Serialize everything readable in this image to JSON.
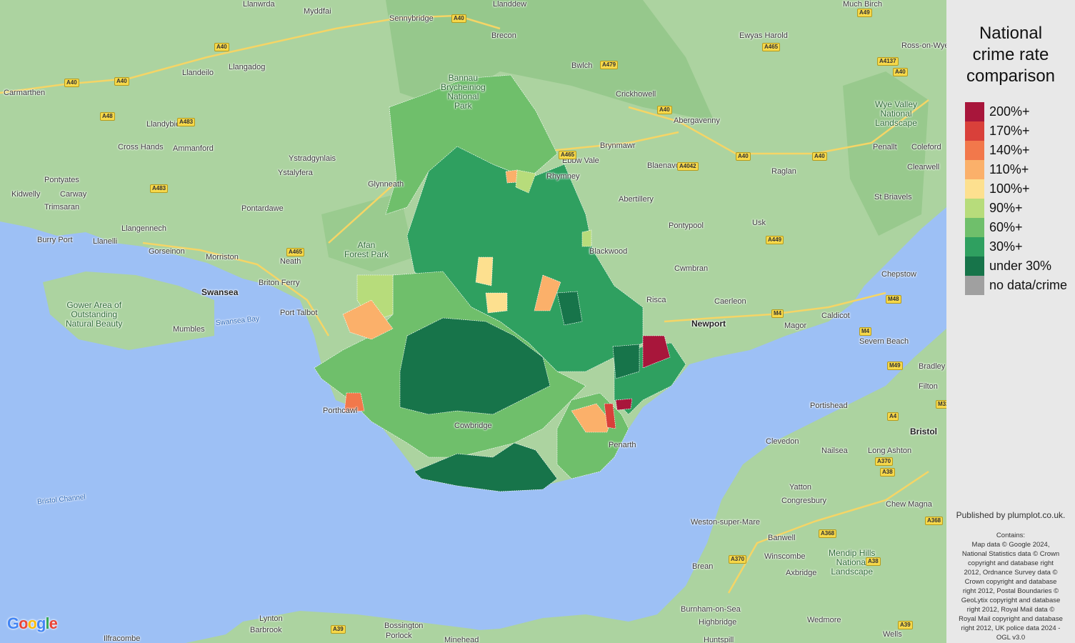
{
  "legend": {
    "title_lines": [
      "National",
      "crime rate",
      "comparison"
    ],
    "items": [
      {
        "label": "200%+",
        "color": "#a8163b"
      },
      {
        "label": "170%+",
        "color": "#d9403a"
      },
      {
        "label": "140%+",
        "color": "#f2784b"
      },
      {
        "label": "110%+",
        "color": "#fbb06a"
      },
      {
        "label": "100%+",
        "color": "#fde08f"
      },
      {
        "label": "90%+",
        "color": "#b7dc7b"
      },
      {
        "label": "60%+",
        "color": "#6fbf6b"
      },
      {
        "label": "30%+",
        "color": "#2fa060"
      },
      {
        "label": "under 30%",
        "color": "#17744a"
      },
      {
        "label": "no data/crime",
        "color": "#a0a0a0"
      }
    ]
  },
  "attribution": {
    "published": "Published by plumplot.co.uk.",
    "contains_lines": [
      "Contains:",
      "Map data © Google 2024,",
      "National Statistics data © Crown",
      "copyright and database right",
      "2012, Ordnance Survey data ©",
      "Crown copyright and database",
      "right 2012, Postal Boundaries ©",
      "GeoLytix copyright and database",
      "right 2012, Royal Mail data ©",
      "Royal Mail copyright and database",
      "right 2012, UK police data 2024 -",
      "OGL v3.0"
    ]
  },
  "map": {
    "google_logo": "Google",
    "places": [
      {
        "name": "Llanwrda",
        "kind": "place"
      },
      {
        "name": "Myddfai",
        "kind": "place"
      },
      {
        "name": "Sennybridge",
        "kind": "place"
      },
      {
        "name": "Llanddew",
        "kind": "place"
      },
      {
        "name": "Brecon",
        "kind": "place"
      },
      {
        "name": "Ewyas Harold",
        "kind": "place"
      },
      {
        "name": "Much Birch",
        "kind": "place"
      },
      {
        "name": "Llangadog",
        "kind": "place"
      },
      {
        "name": "Ross-on-Wye",
        "kind": "place"
      },
      {
        "name": "Llandeilo",
        "kind": "place"
      },
      {
        "name": "Bwlch",
        "kind": "place"
      },
      {
        "name": "Carmarthen",
        "kind": "place"
      },
      {
        "name": "Crickhowell",
        "kind": "place"
      },
      {
        "name": "Llandybie",
        "kind": "place"
      },
      {
        "name": "Abergavenny",
        "kind": "place"
      },
      {
        "name": "Cross Hands",
        "kind": "place"
      },
      {
        "name": "Ammanford",
        "kind": "place"
      },
      {
        "name": "Brynmawr",
        "kind": "place"
      },
      {
        "name": "Penallt",
        "kind": "place"
      },
      {
        "name": "Coleford",
        "kind": "place"
      },
      {
        "name": "Ebbw Vale",
        "kind": "place"
      },
      {
        "name": "Ystradgynlais",
        "kind": "place"
      },
      {
        "name": "Pontyates",
        "kind": "place"
      },
      {
        "name": "Ystalyfera",
        "kind": "place"
      },
      {
        "name": "Blaenavon",
        "kind": "place"
      },
      {
        "name": "Raglan",
        "kind": "place"
      },
      {
        "name": "Clearwell",
        "kind": "place"
      },
      {
        "name": "Kidwelly",
        "kind": "place"
      },
      {
        "name": "Carway",
        "kind": "place"
      },
      {
        "name": "Glynneath",
        "kind": "place"
      },
      {
        "name": "Rhymney",
        "kind": "place"
      },
      {
        "name": "Trimsaran",
        "kind": "place"
      },
      {
        "name": "Abertillery",
        "kind": "place"
      },
      {
        "name": "St Briavels",
        "kind": "place"
      },
      {
        "name": "Pontardawe",
        "kind": "place"
      },
      {
        "name": "Llangennech",
        "kind": "place"
      },
      {
        "name": "Pontypool",
        "kind": "place"
      },
      {
        "name": "Burry Port",
        "kind": "place"
      },
      {
        "name": "Usk",
        "kind": "place"
      },
      {
        "name": "Llanelli",
        "kind": "place"
      },
      {
        "name": "Gorseinon",
        "kind": "place"
      },
      {
        "name": "Morriston",
        "kind": "place"
      },
      {
        "name": "Blackwood",
        "kind": "place"
      },
      {
        "name": "Neath",
        "kind": "place"
      },
      {
        "name": "Cwmbran",
        "kind": "place"
      },
      {
        "name": "Chepstow",
        "kind": "place"
      },
      {
        "name": "Briton Ferry",
        "kind": "place"
      },
      {
        "name": "Swansea",
        "kind": "big"
      },
      {
        "name": "Risca",
        "kind": "place"
      },
      {
        "name": "Caerleon",
        "kind": "place"
      },
      {
        "name": "Caldicot",
        "kind": "place"
      },
      {
        "name": "Port Talbot",
        "kind": "place"
      },
      {
        "name": "Newport",
        "kind": "big"
      },
      {
        "name": "Magor",
        "kind": "place"
      },
      {
        "name": "Mumbles",
        "kind": "place"
      },
      {
        "name": "Severn Beach",
        "kind": "place"
      },
      {
        "name": "Bradley",
        "kind": "place"
      },
      {
        "name": "Filton",
        "kind": "place"
      },
      {
        "name": "Porthcawl",
        "kind": "place"
      },
      {
        "name": "Portishead",
        "kind": "place"
      },
      {
        "name": "Cowbridge",
        "kind": "place"
      },
      {
        "name": "Bristol",
        "kind": "big"
      },
      {
        "name": "Clevedon",
        "kind": "place"
      },
      {
        "name": "Nailsea",
        "kind": "place"
      },
      {
        "name": "Long Ashton",
        "kind": "place"
      },
      {
        "name": "Yatton",
        "kind": "place"
      },
      {
        "name": "Congresbury",
        "kind": "place"
      },
      {
        "name": "Chew Magna",
        "kind": "place"
      },
      {
        "name": "Weston-super-Mare",
        "kind": "place"
      },
      {
        "name": "Banwell",
        "kind": "place"
      },
      {
        "name": "Winscombe",
        "kind": "place"
      },
      {
        "name": "Brean",
        "kind": "place"
      },
      {
        "name": "Axbridge",
        "kind": "place"
      },
      {
        "name": "Burnham-on-Sea",
        "kind": "place"
      },
      {
        "name": "Wedmore",
        "kind": "place"
      },
      {
        "name": "Highbridge",
        "kind": "place"
      },
      {
        "name": "Lynton",
        "kind": "place"
      },
      {
        "name": "Barbrook",
        "kind": "place"
      },
      {
        "name": "Bossington",
        "kind": "place"
      },
      {
        "name": "Porlock",
        "kind": "place"
      },
      {
        "name": "Ilfracombe",
        "kind": "place"
      },
      {
        "name": "Minehead",
        "kind": "place"
      },
      {
        "name": "Wells",
        "kind": "place"
      },
      {
        "name": "Huntspill",
        "kind": "place"
      },
      {
        "name": "Penarth",
        "kind": "place"
      },
      {
        "name": "Bristol Channel",
        "kind": "water"
      },
      {
        "name": "Swansea Bay",
        "kind": "water"
      },
      {
        "name": "Bannau Brycheiniog National Park",
        "kind": "park"
      },
      {
        "name": "Afan Forest Park",
        "kind": "park"
      },
      {
        "name": "Gower Area of Outstanding Natural Beauty",
        "kind": "park"
      },
      {
        "name": "Wye Valley National Landscape",
        "kind": "park"
      },
      {
        "name": "Mendip Hills National Landscape",
        "kind": "park"
      }
    ],
    "roads": [
      "A40",
      "A40",
      "A40",
      "A40",
      "A40",
      "A40",
      "A40",
      "A40",
      "A465",
      "A465",
      "A479",
      "A483",
      "A483",
      "A48",
      "A49",
      "A4137",
      "A4042",
      "A449",
      "A465",
      "M4",
      "M4",
      "M48",
      "M49",
      "A4",
      "A370",
      "A38",
      "A368",
      "A368",
      "A370",
      "A38",
      "A39",
      "A39",
      "M32"
    ]
  }
}
